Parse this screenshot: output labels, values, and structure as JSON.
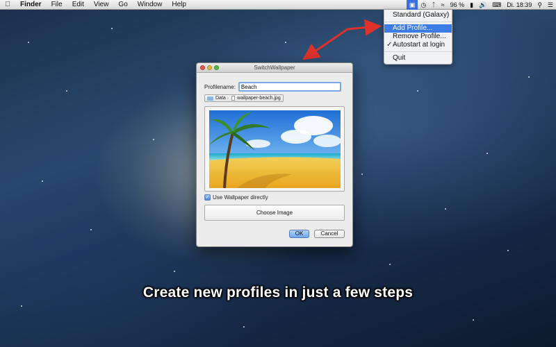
{
  "menubar": {
    "apple_icon": "apple-icon",
    "items": [
      "Finder",
      "File",
      "Edit",
      "View",
      "Go",
      "Window",
      "Help"
    ],
    "status": {
      "battery": "96 %",
      "clock": "Di. 18:39"
    }
  },
  "dropdown": {
    "items": [
      {
        "label": "Standard (Galaxy)",
        "highlighted": false,
        "checked": false
      },
      {
        "label": "Add Profile...",
        "highlighted": true,
        "checked": false
      },
      {
        "label": "Remove Profile...",
        "highlighted": false,
        "checked": false
      },
      {
        "label": "Autostart at login",
        "highlighted": false,
        "checked": true
      },
      {
        "label": "Quit",
        "highlighted": false,
        "checked": false
      }
    ],
    "check_glyph": "✓"
  },
  "window": {
    "title": "SwitchWallpaper",
    "profile_label": "Profilename:",
    "profile_value": "Beach",
    "path": {
      "folder": "Data",
      "file": "wallpaper-beach.jpg"
    },
    "use_directly_label": "Use Wallpaper directly",
    "use_directly_checked": true,
    "choose_label": "Choose Image",
    "ok_label": "OK",
    "cancel_label": "Cancel"
  },
  "caption": "Create new profiles in just a few steps",
  "colors": {
    "accent": "#3d7be5",
    "arrow": "#e0312b",
    "menubar": "#e6e6e6"
  }
}
